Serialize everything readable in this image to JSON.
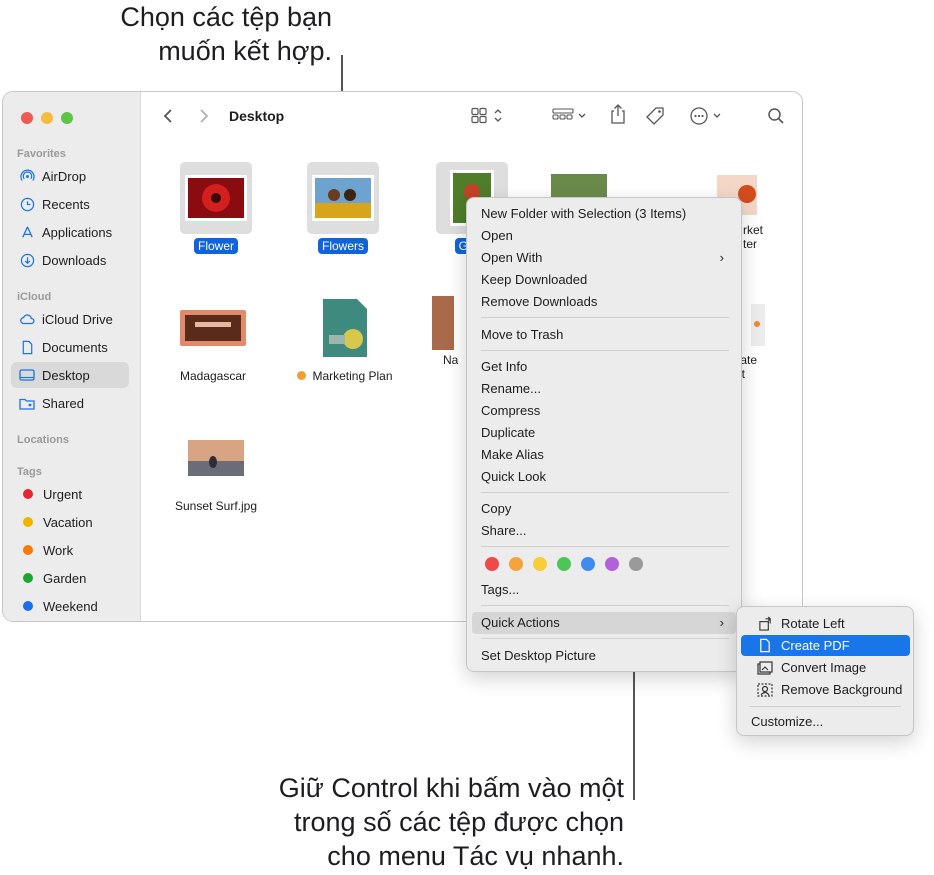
{
  "callouts": {
    "top": [
      "Chọn các tệp bạn",
      "muốn kết hợp."
    ],
    "bottom": [
      "Giữ Control khi bấm vào một",
      "trong số các tệp được chọn",
      "cho menu Tác vụ nhanh."
    ]
  },
  "window": {
    "title": "Desktop"
  },
  "sidebar": {
    "sections": {
      "favorites": "Favorites",
      "icloud": "iCloud",
      "locations": "Locations",
      "tags": "Tags"
    },
    "favorites": [
      {
        "label": "AirDrop",
        "icon": "airdrop-icon"
      },
      {
        "label": "Recents",
        "icon": "clock-icon"
      },
      {
        "label": "Applications",
        "icon": "applications-icon"
      },
      {
        "label": "Downloads",
        "icon": "download-icon"
      }
    ],
    "icloud": [
      {
        "label": "iCloud Drive",
        "icon": "cloud-icon"
      },
      {
        "label": "Documents",
        "icon": "document-icon"
      },
      {
        "label": "Desktop",
        "icon": "desktop-icon",
        "selected": true
      },
      {
        "label": "Shared",
        "icon": "shared-folder-icon"
      }
    ],
    "tags": [
      {
        "label": "Urgent",
        "color": "#e5272f"
      },
      {
        "label": "Vacation",
        "color": "#f0b400"
      },
      {
        "label": "Work",
        "color": "#f57c00"
      },
      {
        "label": "Garden",
        "color": "#1ba631"
      },
      {
        "label": "Weekend",
        "color": "#1c6fe8"
      }
    ]
  },
  "files": [
    {
      "name": "Flower",
      "selected": true
    },
    {
      "name": "Flowers",
      "selected": true
    },
    {
      "name": "Gard",
      "selected": true
    },
    {
      "name": "rket",
      "sub": "ter"
    },
    {
      "name": "Madagascar"
    },
    {
      "name": "Marketing Plan",
      "tag_color": "#f0a030"
    },
    {
      "name": "Na"
    },
    {
      "name": "ate",
      "sub": "t"
    },
    {
      "name": "Sunset Surf.jpg"
    }
  ],
  "context_menu": {
    "items": [
      "New Folder with Selection (3 Items)",
      "Open",
      "Open With",
      "Keep Downloaded",
      "Remove Downloads",
      "Move to Trash",
      "Get Info",
      "Rename...",
      "Compress",
      "Duplicate",
      "Make Alias",
      "Quick Look",
      "Copy",
      "Share...",
      "Tags...",
      "Quick Actions",
      "Set Desktop Picture"
    ],
    "tag_colors": [
      "#ee4a4a",
      "#f5a33c",
      "#f7cd3a",
      "#4ec656",
      "#3f8cf0",
      "#b361d9",
      "#9a9a9a"
    ]
  },
  "quick_actions": {
    "items": [
      "Rotate Left",
      "Create PDF",
      "Convert Image",
      "Remove Background"
    ],
    "customize": "Customize..."
  }
}
